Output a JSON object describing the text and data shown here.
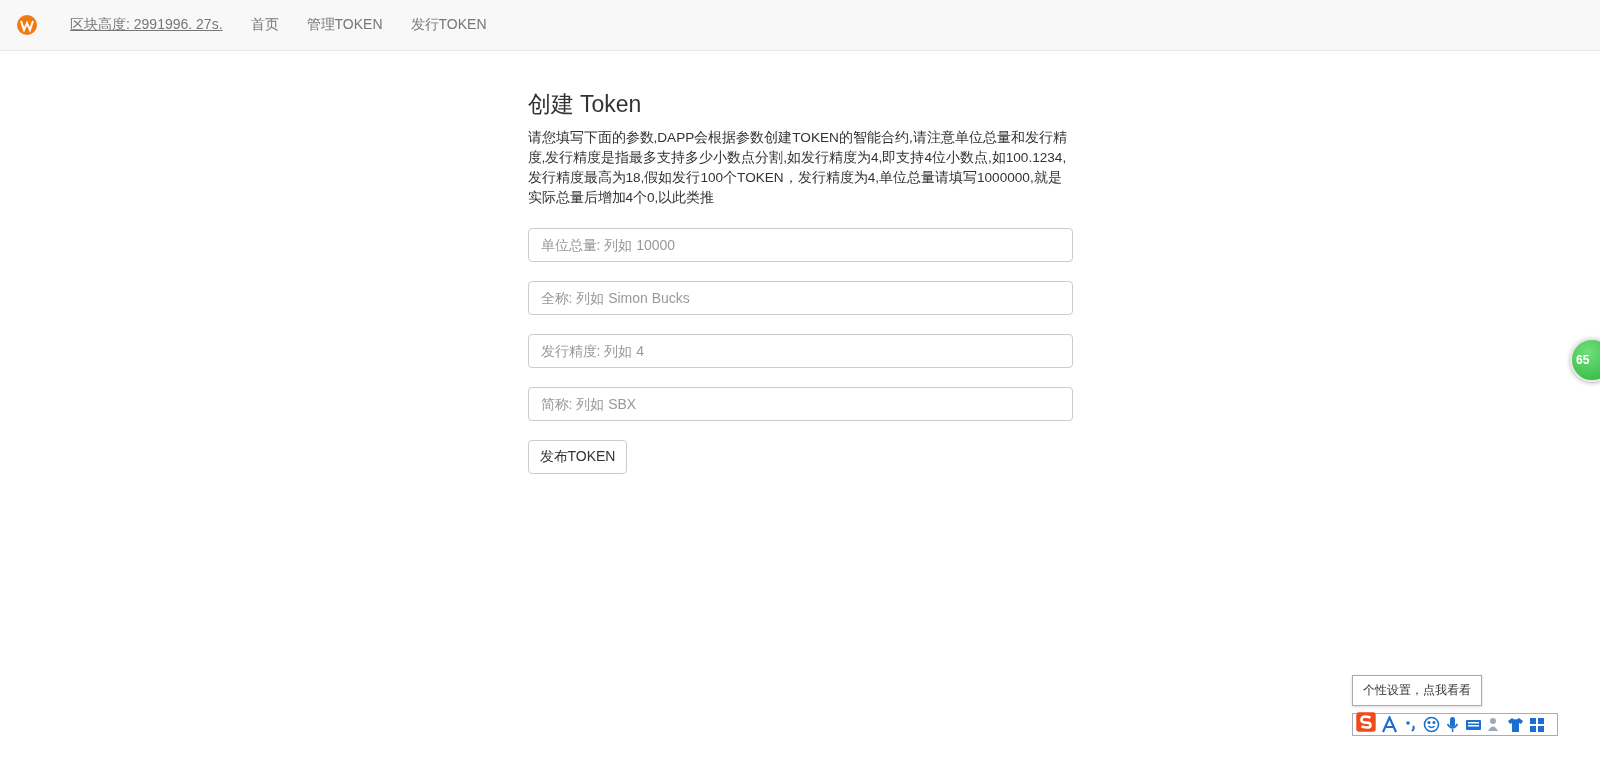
{
  "navbar": {
    "block_height": "区块高度: 2991996. 27s.",
    "links": [
      "首页",
      "管理TOKEN",
      "发行TOKEN"
    ]
  },
  "form": {
    "title": "创建 Token",
    "description": "请您填写下面的参数,DAPP会根据参数创建TOKEN的智能合约,请注意单位总量和发行精度,发行精度是指最多支持多少小数点分割,如发行精度为4,即支持4位小数点,如100.1234,发行精度最高为18,假如发行100个TOKEN，发行精度为4,单位总量请填写1000000,就是实际总量后增加4个0,以此类推",
    "fields": [
      {
        "placeholder": "单位总量: 列如 10000"
      },
      {
        "placeholder": "全称: 列如 Simon Bucks"
      },
      {
        "placeholder": "发行精度: 列如 4"
      },
      {
        "placeholder": "简称: 列如 SBX"
      }
    ],
    "submit": "发布TOKEN"
  },
  "floating_ball": {
    "text": "65"
  },
  "ime_toolbar": {
    "tooltip": "个性设置，点我看看"
  }
}
